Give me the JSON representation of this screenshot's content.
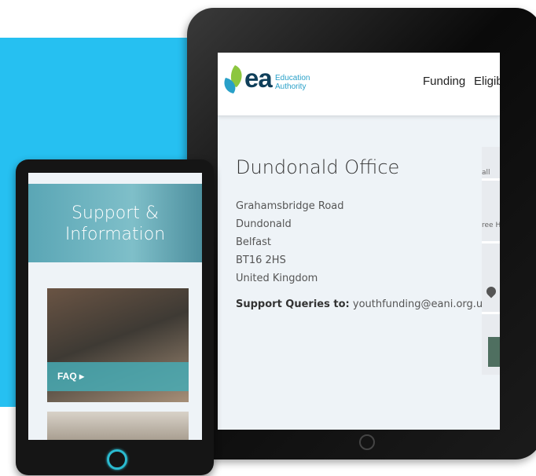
{
  "header": {
    "logo_text": "ea",
    "logo_sub_line1": "Education",
    "logo_sub_line2": "Authority",
    "nav": [
      "Funding",
      "Eligib"
    ]
  },
  "office": {
    "title": "Dundonald Office",
    "address": [
      "Grahamsbridge Road",
      "Dundonald",
      "Belfast",
      "BT16 2HS",
      "United Kingdom"
    ],
    "support_label": "Support Queries to:",
    "support_email": "youthfunding@eani.org.uk"
  },
  "map": {
    "labels": [
      "all",
      "ree H"
    ],
    "pin_icon": "map-pin-icon"
  },
  "mobile": {
    "hero_title_line1": "Support &",
    "hero_title_line2": "Information",
    "faq_label": "FAQ ▸"
  },
  "colors": {
    "brand_blue": "#26c0f1",
    "teal": "#46aab4",
    "navy": "#0f3f5a",
    "leaf_green": "#8cc63f"
  }
}
